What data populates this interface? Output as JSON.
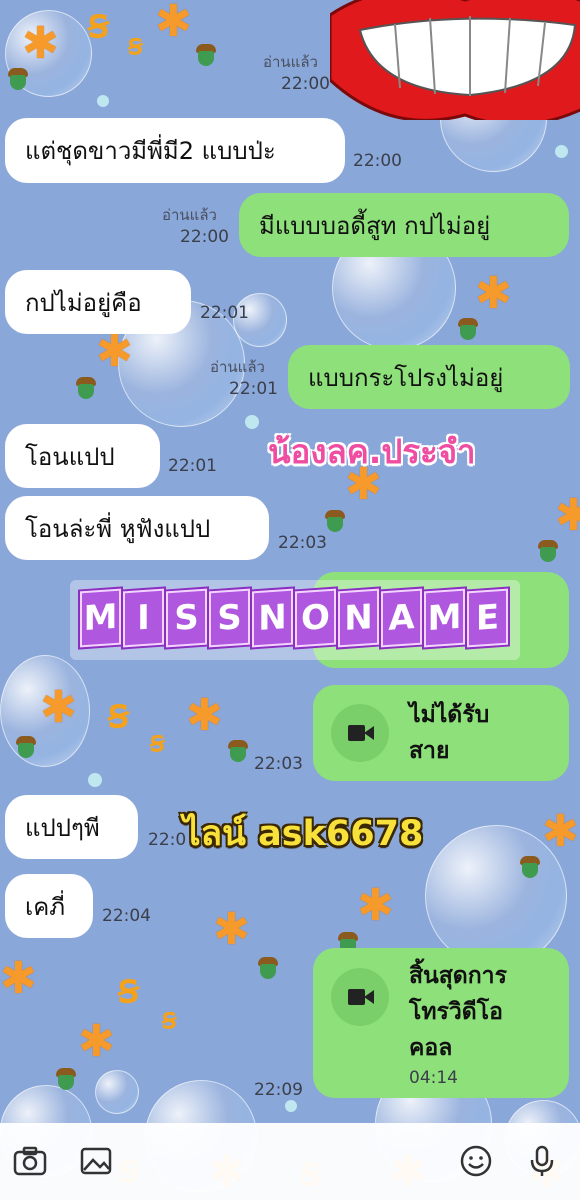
{
  "messages": [
    {
      "id": "m1",
      "side": "out",
      "text": "",
      "read": "อ่านแล้ว",
      "time": "22:00"
    },
    {
      "id": "m2",
      "side": "in",
      "text": "แต่ชุดขาวมีพี่มี2 แบบป่ะ",
      "time": "22:00"
    },
    {
      "id": "m3",
      "side": "out",
      "text": "มีแบบบอดี้สูท กปไม่อยู่",
      "read": "อ่านแล้ว",
      "time": "22:00"
    },
    {
      "id": "m4",
      "side": "in",
      "text": "กปไม่อยู่คือ",
      "time": "22:01"
    },
    {
      "id": "m5",
      "side": "out",
      "text": "แบบกระโปรงไม่อยู่",
      "read": "อ่านแล้ว",
      "time": "22:01"
    },
    {
      "id": "m6",
      "side": "in",
      "text": "โอนแปป",
      "time": "22:01"
    },
    {
      "id": "m7",
      "side": "in",
      "text": "โอนล่ะพี่ หูฟังแปป",
      "time": "22:03"
    },
    {
      "id": "m8",
      "side": "out",
      "text": "",
      "time": ""
    },
    {
      "id": "m10",
      "side": "in",
      "text": "แปปๆพี",
      "time": "22:0"
    },
    {
      "id": "m11",
      "side": "in",
      "text": "เคภี่",
      "time": "22:04"
    }
  ],
  "calls": [
    {
      "id": "c1",
      "icon": "video-camera-icon",
      "text": "ไม่ได้รับ\nสาย",
      "time": "22:03"
    },
    {
      "id": "c2",
      "icon": "video-camera-icon",
      "text": "สิ้นสุดการ\nโทรวิดีโอ\nคอล",
      "duration": "04:14",
      "time": "22:09"
    }
  ],
  "overlays": {
    "pink_caption": "น้องลค.ประจำ",
    "brand_letters": [
      "M",
      "I",
      "S",
      "S",
      "N",
      "O",
      "N",
      "A",
      "M",
      "E"
    ],
    "line_id": "ไลน์ ask6678"
  },
  "input_bar": {
    "icons": [
      "camera-icon",
      "image-icon",
      "emoji-icon",
      "microphone-icon"
    ]
  },
  "colors": {
    "background": "#8aa7d9",
    "incoming_bubble": "#ffffff",
    "outgoing_bubble": "#8ee07a",
    "pink_caption": "#ee4da1",
    "brand_tile": "#b057e0",
    "line_id_text": "#f7e13a"
  }
}
